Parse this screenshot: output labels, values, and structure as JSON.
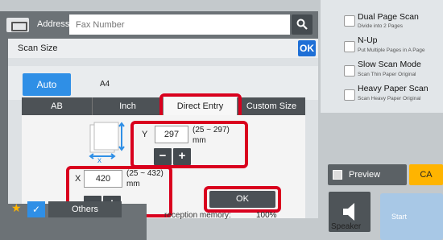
{
  "header": {
    "address_label": "Address",
    "fax_placeholder": "Fax Number"
  },
  "dialog": {
    "title": "Scan Size",
    "ok_label": "OK",
    "auto_label": "Auto",
    "size_value": "A4",
    "tabs": [
      {
        "label": "AB"
      },
      {
        "label": "Inch"
      },
      {
        "label": "Direct Entry"
      },
      {
        "label": "Custom Size"
      }
    ],
    "y": {
      "label": "Y",
      "value": "297",
      "range": "(25 ~ 297)",
      "unit": "mm"
    },
    "x": {
      "label": "X",
      "value": "420",
      "range": "(25 ~ 432)",
      "unit": "mm"
    },
    "minus": "−",
    "plus": "+",
    "ok_button": "OK",
    "dim_marker": "x"
  },
  "right_panel": {
    "items": [
      {
        "title": "Dual Page Scan",
        "subtitle": "Divide into 2 Pages"
      },
      {
        "title": "N-Up",
        "subtitle": "Put Multiple Pages in A Page"
      },
      {
        "title": "Slow Scan Mode",
        "subtitle": "Scan Thin Paper Original"
      },
      {
        "title": "Heavy Paper Scan",
        "subtitle": "Scan Heavy Paper Original"
      }
    ]
  },
  "bottom": {
    "others_label": "Others",
    "memory_text": "reception memory:",
    "memory_value": "100%",
    "preview_label": "Preview",
    "ca_label": "CA",
    "speaker_label": "Speaker",
    "start_label": "Start"
  },
  "colors": {
    "accent_blue": "#2f8fe6",
    "highlight_red": "#d9001e",
    "ca_yellow": "#ffb400"
  }
}
